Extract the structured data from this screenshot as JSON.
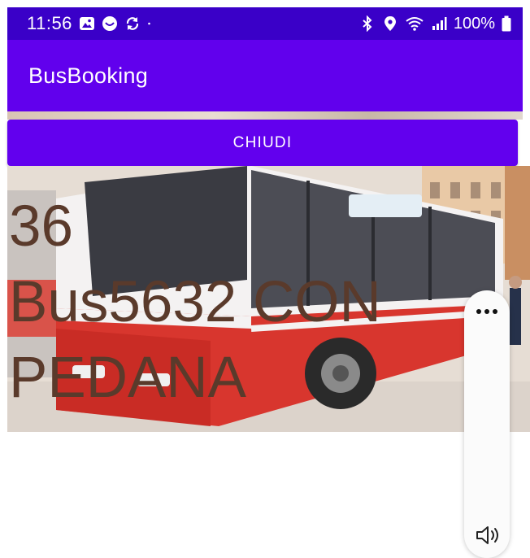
{
  "status_bar": {
    "time": "11:56",
    "battery": "100%",
    "left_icons": [
      "gallery-icon",
      "messenger-icon",
      "sync-icon",
      "dot-icon"
    ],
    "right_icons": [
      "bluetooth-icon",
      "location-icon",
      "wifi-icon",
      "signal-icon",
      "battery-icon"
    ]
  },
  "app_bar": {
    "title": "BusBooking"
  },
  "close_button": {
    "label": "CHIUDI"
  },
  "bus": {
    "info": "36\nBus5632 CON\nPEDANA"
  },
  "volume_panel": {
    "icons": [
      "more-options-icon",
      "speaker-icon"
    ]
  },
  "colors": {
    "status_bar": "#3a00c8",
    "app_bar": "#6100ed",
    "button": "#6200ee",
    "bus_text": "#5a3a2b"
  }
}
